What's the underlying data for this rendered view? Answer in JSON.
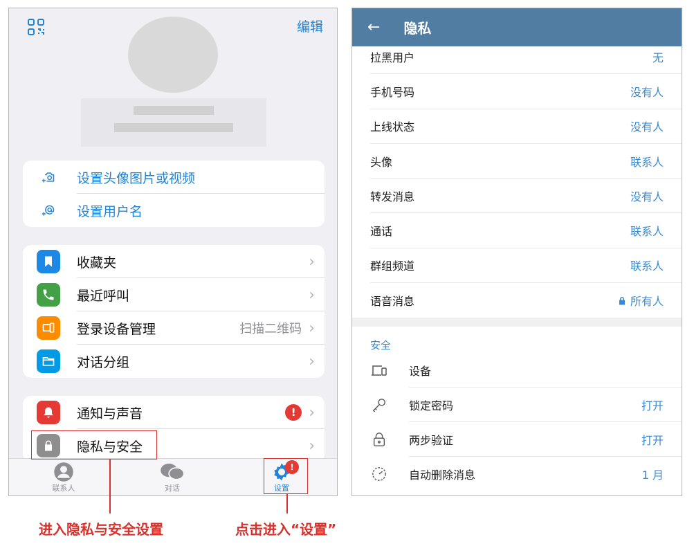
{
  "left": {
    "edit_label": "编辑",
    "profile_group": [
      {
        "label": "设置头像图片或视频",
        "icon": "camera-add-icon"
      },
      {
        "label": "设置用户名",
        "icon": "at-sign-icon"
      }
    ],
    "menu_group": [
      {
        "label": "收藏夹",
        "icon": "bookmark-icon",
        "color": "#1e88e5"
      },
      {
        "label": "最近呼叫",
        "icon": "phone-icon",
        "color": "#43a047"
      },
      {
        "label": "登录设备管理",
        "value": "扫描二维码",
        "icon": "devices-icon",
        "color": "#fb8c00"
      },
      {
        "label": "对话分组",
        "icon": "folder-icon",
        "color": "#039be5"
      }
    ],
    "settings_group": [
      {
        "label": "通知与声音",
        "badge": "!",
        "icon": "bell-icon",
        "color": "#e53935"
      },
      {
        "label": "隐私与安全",
        "icon": "lock-icon",
        "color": "#8e8e8e"
      }
    ],
    "tabs": [
      {
        "label": "联系人",
        "icon": "person-icon"
      },
      {
        "label": "对话",
        "icon": "chat-icon"
      },
      {
        "label": "设置",
        "icon": "gear-icon",
        "badge": "!"
      }
    ]
  },
  "annotations": {
    "privacy_caption": "进入隐私与安全设置",
    "settings_caption": "点击进入“设置”"
  },
  "right": {
    "title": "隐私",
    "privacy_rows": [
      {
        "label": "拉黑用户",
        "value": "无"
      },
      {
        "label": "手机号码",
        "value": "没有人"
      },
      {
        "label": "上线状态",
        "value": "没有人"
      },
      {
        "label": "头像",
        "value": "联系人"
      },
      {
        "label": "转发消息",
        "value": "没有人"
      },
      {
        "label": "通话",
        "value": "联系人"
      },
      {
        "label": "群组频道",
        "value": "联系人"
      },
      {
        "label": "语音消息",
        "value": "所有人",
        "locked": true
      }
    ],
    "security_title": "安全",
    "security_rows": [
      {
        "label": "设备",
        "value": "",
        "icon": "devices-icon"
      },
      {
        "label": "锁定密码",
        "value": "打开",
        "icon": "key-icon"
      },
      {
        "label": "两步验证",
        "value": "打开",
        "icon": "lock-icon"
      },
      {
        "label": "自动删除消息",
        "value": "1 月",
        "icon": "timer-icon"
      }
    ]
  }
}
